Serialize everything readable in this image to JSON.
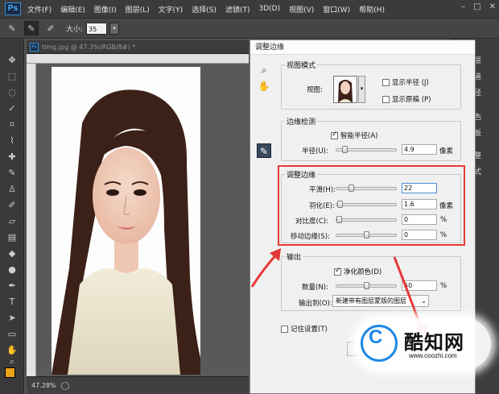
{
  "app": {
    "logo": "Ps"
  },
  "menu": [
    "文件(F)",
    "编辑(E)",
    "图像(I)",
    "图层(L)",
    "文字(Y)",
    "选择(S)",
    "滤镜(T)",
    "3D(D)",
    "视图(V)",
    "窗口(W)",
    "帮助(H)"
  ],
  "window_controls": {
    "minimize": "–",
    "maximize": "□",
    "close": "✕"
  },
  "options": {
    "size_label": "大小:",
    "size_value": "35",
    "dropdown_arrow": "▾"
  },
  "toolbar": {
    "fg_color": "#e8a317",
    "bg_color": "#f4f4f4"
  },
  "document": {
    "title": "timg.jpg @ 47.3%(RGB/8#) *",
    "zoom": "47.28%"
  },
  "right_panel": [
    "图层",
    "通道",
    "路径",
    "颜色",
    "色板",
    "调整",
    "样式"
  ],
  "dialog": {
    "title": "调整边缘",
    "view_mode": {
      "legend": "视图模式",
      "view_label": "视图:",
      "show_radius": "显示半径 (J)",
      "show_original": "显示原稿 (P)"
    },
    "edge_detection": {
      "legend": "边缘检测",
      "smart_radius": "智能半径(A)",
      "radius_label": "半径(U):",
      "radius_value": "4.9",
      "radius_unit": "像素",
      "radius_level": 0.1
    },
    "adjust_edge": {
      "legend": "调整边缘",
      "smooth_label": "平滑(H):",
      "smooth_value": "22",
      "smooth_level": 0.22,
      "feather_label": "羽化(E):",
      "feather_value": "1.6",
      "feather_unit": "像素",
      "feather_level": 0.02,
      "contrast_label": "对比度(C):",
      "contrast_value": "0",
      "contrast_unit": "%",
      "contrast_level": 0,
      "shift_label": "移动边缘(S):",
      "shift_value": "0",
      "shift_unit": "%",
      "shift_level": 0.5
    },
    "output": {
      "legend": "输出",
      "decontaminate": "净化颜色(D)",
      "amount_label": "数量(N):",
      "amount_value": "50",
      "amount_unit": "%",
      "amount_level": 0.5,
      "output_to_label": "输出到(O):",
      "output_to_value": "新建带有图层蒙版的图层",
      "dropdown_arrow": "⌄"
    },
    "remember": "记住设置(T)"
  },
  "watermark": {
    "logo_letter": "C",
    "name": "酷知网",
    "url": "www.coozhi.com"
  }
}
